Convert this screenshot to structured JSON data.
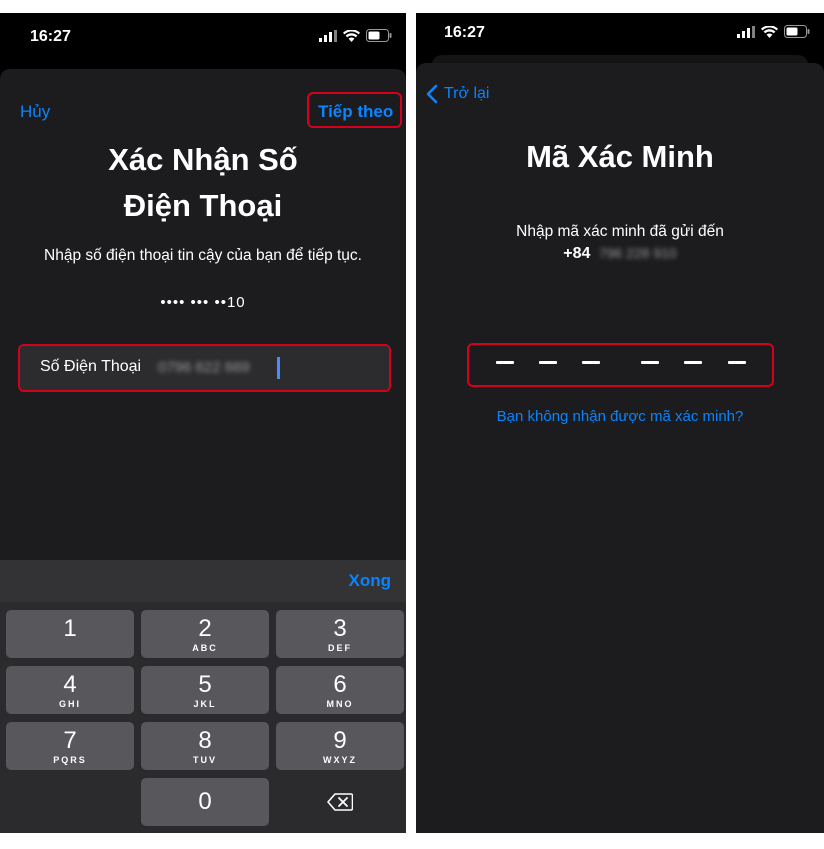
{
  "left_screen": {
    "status": {
      "time": "16:27"
    },
    "nav": {
      "cancel_label": "Hủy",
      "next_label": "Tiếp theo"
    },
    "title_line1": "Xác Nhận Số",
    "title_line2": "Điện Thoại",
    "subtitle": "Nhập số điện thoại tin cậy của bạn để tiếp tục.",
    "masked_number": "•••• ••• ••10",
    "phone_field": {
      "label": "Số Điện Thoại",
      "value": "0796 622 669"
    },
    "keyboard": {
      "done_label": "Xong",
      "keys": [
        {
          "digit": "1",
          "letters": ""
        },
        {
          "digit": "2",
          "letters": "ABC"
        },
        {
          "digit": "3",
          "letters": "DEF"
        },
        {
          "digit": "4",
          "letters": "GHI"
        },
        {
          "digit": "5",
          "letters": "JKL"
        },
        {
          "digit": "6",
          "letters": "MNO"
        },
        {
          "digit": "7",
          "letters": "PQRS"
        },
        {
          "digit": "8",
          "letters": "TUV"
        },
        {
          "digit": "9",
          "letters": "WXYZ"
        },
        {
          "digit": "0",
          "letters": ""
        }
      ]
    }
  },
  "right_screen": {
    "status": {
      "time": "16:27"
    },
    "nav": {
      "back_label": "Trở lại"
    },
    "title": "Mã Xác Minh",
    "subtitle": "Nhập mã xác minh đã gửi đến",
    "country_code": "+84",
    "phone_number": "796 228 910",
    "code_length": 6,
    "help_link": "Bạn không nhận được mã xác minh?"
  },
  "colors": {
    "accent": "#0a84ff",
    "highlight": "#d6001c",
    "sheet": "#1c1c1e",
    "key": "#58585c"
  }
}
